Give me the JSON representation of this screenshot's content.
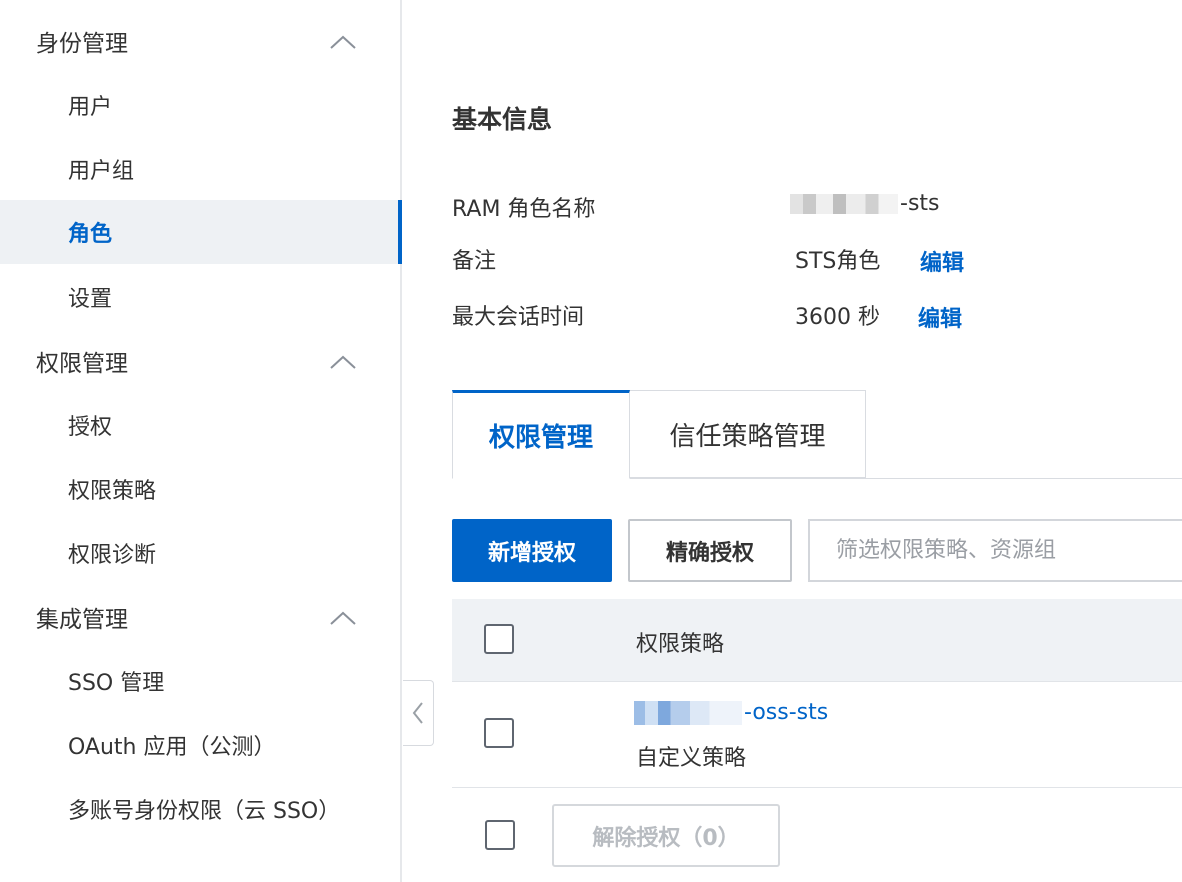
{
  "sidebar": {
    "groups": [
      {
        "label": "身份管理",
        "items": [
          "用户",
          "用户组",
          "角色",
          "设置"
        ]
      },
      {
        "label": "权限管理",
        "items": [
          "授权",
          "权限策略",
          "权限诊断"
        ]
      },
      {
        "label": "集成管理",
        "items": [
          "SSO 管理",
          "OAuth 应用（公测）",
          "多账号身份权限（云 SSO）"
        ]
      }
    ],
    "active_item": "角色"
  },
  "basic_info": {
    "title": "基本信息",
    "role_name_label": "RAM 角色名称",
    "role_name_suffix": "-sts",
    "note_label": "备注",
    "note_value": "STS角色",
    "session_label": "最大会话时间",
    "session_value": "3600 秒",
    "edit_label": "编辑"
  },
  "tabs": {
    "permissions": "权限管理",
    "trust_policy": "信任策略管理"
  },
  "toolbar": {
    "add_grant": "新增授权",
    "precise_grant": "精确授权",
    "search_placeholder": "筛选权限策略、资源组"
  },
  "table": {
    "header_policy": "权限策略",
    "rows": [
      {
        "policy_suffix": "-oss-sts",
        "policy_type": "自定义策略"
      }
    ]
  },
  "footer": {
    "revoke_label": "解除授权（0）"
  },
  "colors": {
    "accent": "#0064c8",
    "active_bg": "#eef1f4",
    "table_header_bg": "#eff2f5"
  }
}
